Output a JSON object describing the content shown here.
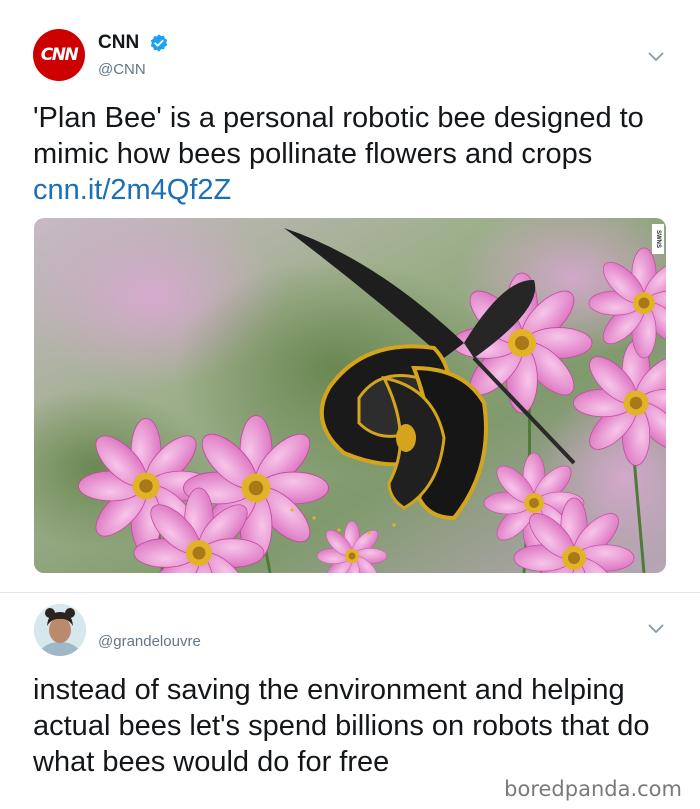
{
  "tweet": {
    "author_name": "CNN",
    "author_handle": "@CNN",
    "avatar_text": "CNN",
    "text": "'Plan Bee' is a personal robotic bee designed to mimic how bees pollinate flowers and crops ",
    "link": "cnn.it/2m4Qf2Z",
    "media_watermark": "SWNS"
  },
  "reply": {
    "author_handle": "@grandelouvre",
    "text": "instead of saving the environment and helping actual bees let's spend billions on robots that do what bees would do for free"
  },
  "footer": {
    "credit": "boredpanda.com"
  },
  "colors": {
    "cnn_red": "#cc0000",
    "verified_blue": "#1da1f2",
    "link_blue": "#1b6fb5",
    "muted": "#657786"
  },
  "icons": {
    "verified": "verified-badge-icon",
    "menu": "chevron-down-icon"
  }
}
